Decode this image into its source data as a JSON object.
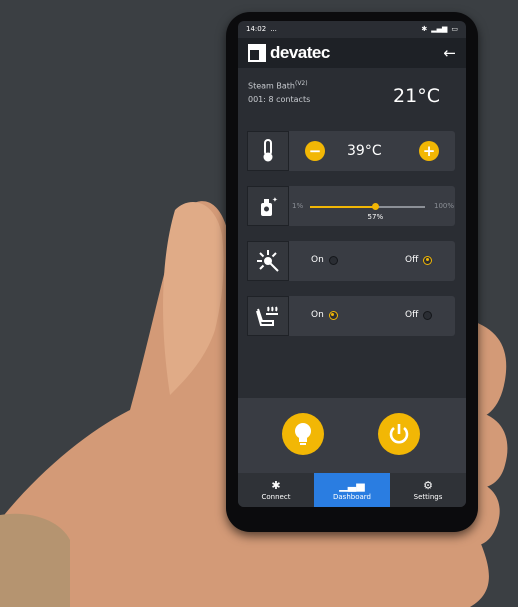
{
  "status": {
    "time": "14:02",
    "extra": "..."
  },
  "app": {
    "brand": "devatec",
    "back_icon": "arrow-left-icon"
  },
  "device": {
    "name": "Steam Bath",
    "version": "(V2)",
    "contacts": "001: 8  contacts",
    "room_temp": "21°C"
  },
  "controls": {
    "temperature": {
      "icon": "thermometer-icon",
      "minus": "−",
      "plus": "+",
      "setpoint": "39°C"
    },
    "fragrance": {
      "icon": "fragrance-icon",
      "min": "1%",
      "max": "100%",
      "value_label": "57%",
      "value": 0.57
    },
    "light": {
      "icon": "light-icon",
      "on_label": "On",
      "off_label": "Off",
      "selected": "off"
    },
    "seat": {
      "icon": "heated-seat-icon",
      "on_label": "On",
      "off_label": "Off",
      "selected": "on"
    }
  },
  "actions": {
    "light_button": "bulb-icon",
    "power_button": "power-icon"
  },
  "nav": {
    "items": [
      {
        "label": "Connect",
        "icon": "bluetooth-icon"
      },
      {
        "label": "Dashboard",
        "icon": "bar-chart-icon"
      },
      {
        "label": "Settings",
        "icon": "gear-icon"
      }
    ],
    "active": "Dashboard"
  },
  "colors": {
    "accent": "#f2b705",
    "nav_active": "#2a7de1",
    "background": "#2a2d33"
  }
}
